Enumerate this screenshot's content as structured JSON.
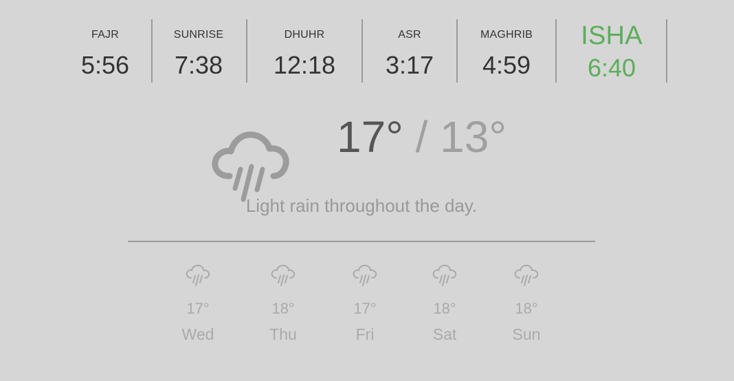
{
  "prayer_times": [
    {
      "name": "FAJR",
      "time": "5:56"
    },
    {
      "name": "SUNRISE",
      "time": "7:38"
    },
    {
      "name": "DHUHR",
      "time": "12:18"
    },
    {
      "name": "ASR",
      "time": "3:17"
    },
    {
      "name": "MAGHRIB",
      "time": "4:59"
    },
    {
      "name": "ISHA",
      "time": "6:40",
      "active": true
    }
  ],
  "current": {
    "high": "17°",
    "separator": "/",
    "low": "13°",
    "summary": "Light rain throughout the day.",
    "icon": "rain-cloud-icon"
  },
  "forecast": [
    {
      "day": "Wed",
      "temp": "17°",
      "icon": "rain-cloud-icon"
    },
    {
      "day": "Thu",
      "temp": "18°",
      "icon": "rain-cloud-icon"
    },
    {
      "day": "Fri",
      "temp": "17°",
      "icon": "rain-cloud-icon"
    },
    {
      "day": "Sat",
      "temp": "18°",
      "icon": "rain-cloud-icon"
    },
    {
      "day": "Sun",
      "temp": "18°",
      "icon": "rain-cloud-icon"
    }
  ],
  "colors": {
    "background": "#d6d6d6",
    "active_prayer": "#5cad5c",
    "primary_text": "#333333",
    "muted_text": "#999999"
  }
}
